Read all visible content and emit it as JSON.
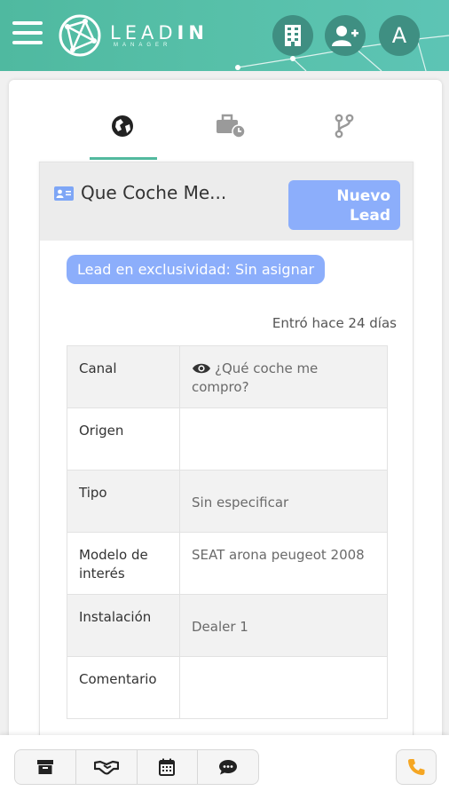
{
  "header": {
    "brand_light": "LEAD",
    "brand_bold": "IN",
    "brand_sub": "MANAGER",
    "avatar_letter": "A",
    "icons": [
      "menu-icon",
      "building-icon",
      "add-user-icon"
    ]
  },
  "tabs": [
    {
      "icon": "globe-icon",
      "active": true
    },
    {
      "icon": "briefcase-clock-icon",
      "active": false
    },
    {
      "icon": "branch-icon",
      "active": false
    }
  ],
  "lead": {
    "title": "Que Coche Me...",
    "new_button_line1": "Nuevo",
    "new_button_line2": "Lead",
    "exclusivity": "Lead en exclusividad: Sin asignar",
    "entered": "Entró hace 24 días"
  },
  "details": [
    {
      "label": "Canal",
      "value": "¿Qué coche me compro?",
      "icon": "eye-icon"
    },
    {
      "label": "Origen",
      "value": ""
    },
    {
      "label": "Tipo",
      "value": "Sin especificar"
    },
    {
      "label": "Modelo de interés",
      "value": "SEAT arona peugeot 2008"
    },
    {
      "label": "Instalación",
      "value": "Dealer 1"
    },
    {
      "label": "Comentario",
      "value": ""
    }
  ],
  "bottom_actions": [
    "archive-icon",
    "handshake-icon",
    "calendar-icon",
    "chat-icon"
  ],
  "colors": {
    "brand": "#52b99e",
    "accent": "#8caefb",
    "phone": "#f5a623"
  }
}
